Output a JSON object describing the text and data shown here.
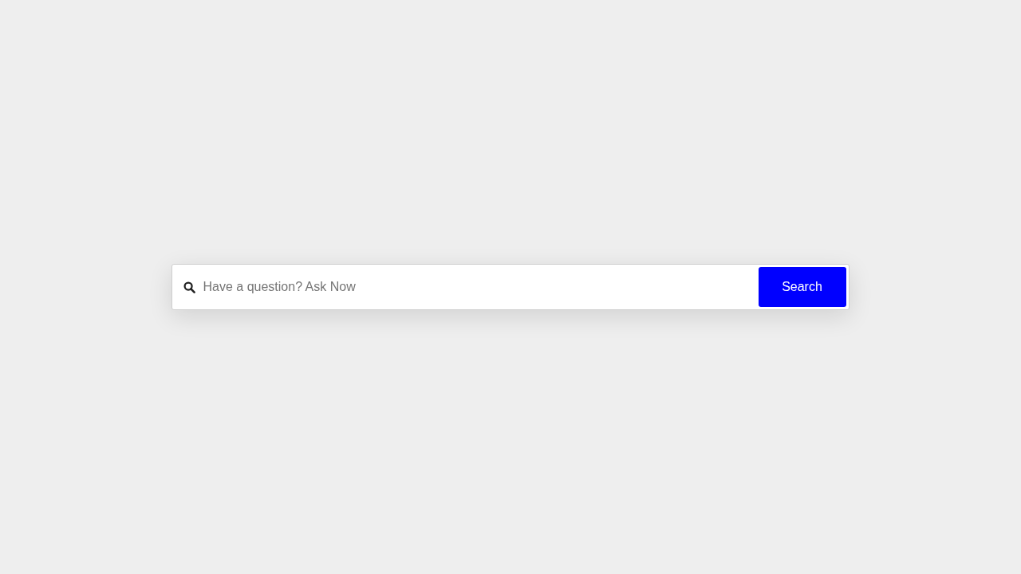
{
  "search": {
    "placeholder": "Have a question? Ask Now",
    "button": "Search"
  }
}
